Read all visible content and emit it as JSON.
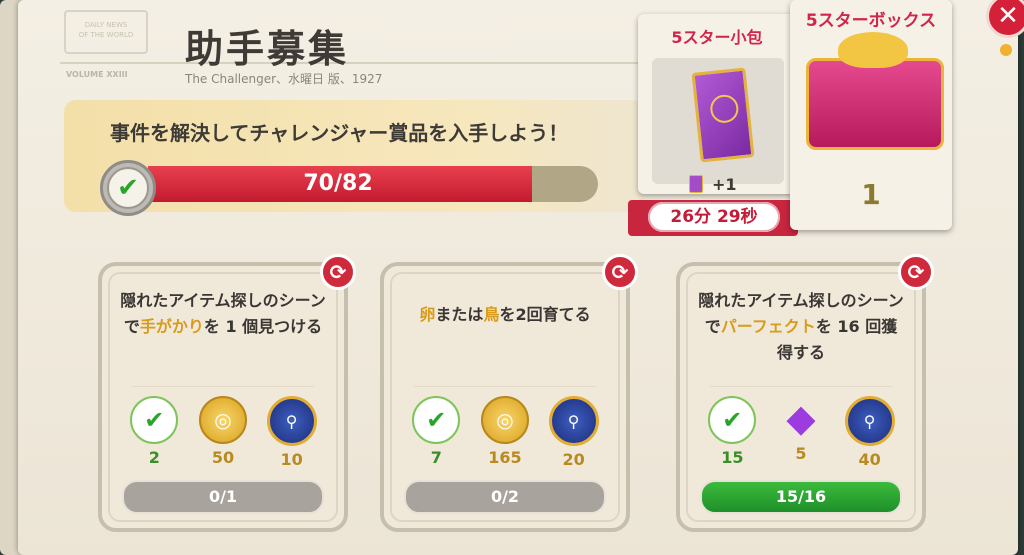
{
  "header": {
    "stamp_line1": "DAILY NEWS",
    "stamp_line2": "OF THE WORLD",
    "stamp_sub": "VOLUME XXIII",
    "title": "助手募集",
    "subtitle": "The Challenger、水曜日 版、1927"
  },
  "goal": {
    "text": "事件を解決してチャレンジャー賞品を入手しよう！",
    "progress_text": "70/82",
    "progress_fraction": 0.853,
    "check_icon": "check-mark-icon"
  },
  "rewards_panel": {
    "small": {
      "title": "5スター小包",
      "count": "+1",
      "timer": "26分 29秒"
    },
    "big": {
      "title": "5スターボックス",
      "count": "1"
    }
  },
  "tasks": [
    {
      "text_parts": [
        "隠れたアイテム探しのシーンで",
        "手がかり",
        "を 1 個見つける"
      ],
      "rewards": [
        {
          "icon": "energy-check-icon",
          "value": "2"
        },
        {
          "icon": "coin-icon",
          "value": "50"
        },
        {
          "icon": "magnifier-badge-icon",
          "value": "10"
        }
      ],
      "progress": "0/1"
    },
    {
      "text_parts": [
        "卵",
        "または",
        "鳥",
        "を2回育てる"
      ],
      "rewards": [
        {
          "icon": "energy-check-icon",
          "value": "7"
        },
        {
          "icon": "coin-icon",
          "value": "165"
        },
        {
          "icon": "magnifier-badge-icon",
          "value": "20"
        }
      ],
      "progress": "0/2"
    },
    {
      "text_parts": [
        "隠れたアイテム探しのシーンで",
        "パーフェクト",
        "を 16 回獲得する"
      ],
      "rewards": [
        {
          "icon": "energy-check-icon",
          "value": "15"
        },
        {
          "icon": "gem-icon",
          "value": "5"
        },
        {
          "icon": "magnifier-badge-icon",
          "value": "40"
        }
      ],
      "progress": "15/16"
    }
  ],
  "colors": {
    "accent_red": "#d1254a",
    "progress_red": "#c31a30",
    "progress_green": "#1f8f2a",
    "gold_text": "#b98a20"
  }
}
